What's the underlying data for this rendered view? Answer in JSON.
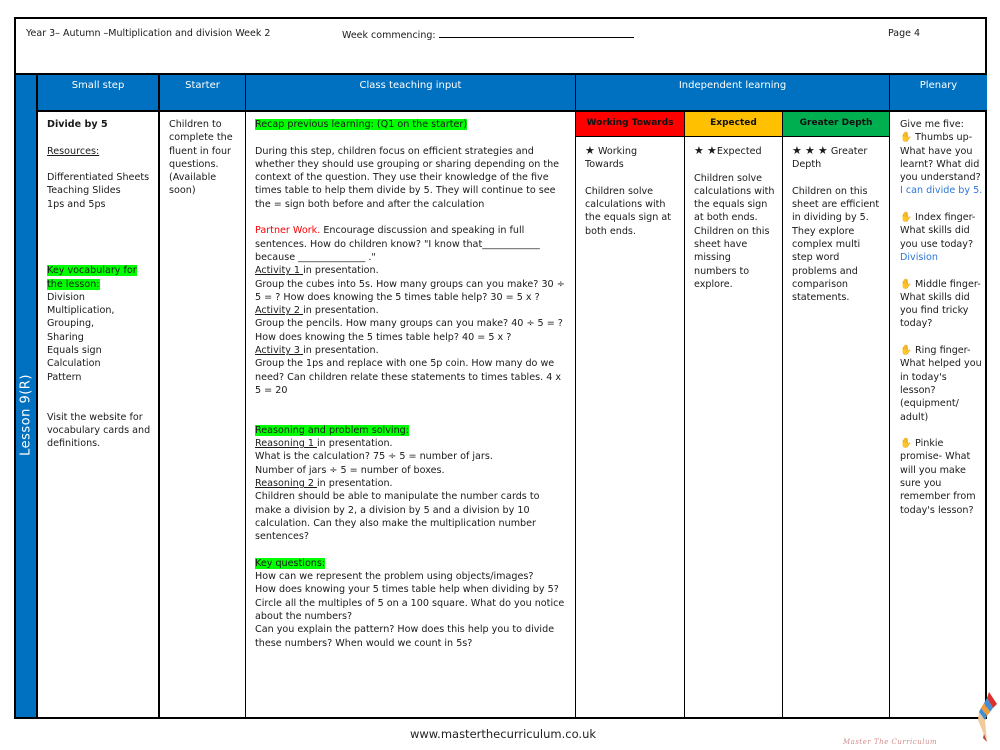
{
  "header": {
    "title": "Year 3– Autumn –Multiplication and division Week 2",
    "week_commencing_label": "Week commencing:",
    "page": "Page 4"
  },
  "side_label": "Lesson 9(R)",
  "columns": {
    "small_step": "Small step",
    "starter": "Starter",
    "class_teaching": "Class teaching input",
    "independent": "Independent learning",
    "plenary": "Plenary"
  },
  "small_step": {
    "title": "Divide by 5",
    "resources_label": "Resources:",
    "resources": [
      "Differentiated Sheets",
      "Teaching Slides",
      "1ps and 5ps"
    ],
    "vocab_label": "Key vocabulary for the lesson:",
    "vocab": [
      "Division",
      "Multiplication,",
      "Grouping,",
      "Sharing",
      "Equals sign",
      "Calculation",
      "Pattern"
    ],
    "website_note": "Visit the website for vocabulary cards and definitions."
  },
  "starter": {
    "text": "Children to complete the fluent in four questions. (Available soon)"
  },
  "teaching": {
    "recap": "Recap previous learning: (Q1 on the starter)",
    "intro": "During this step, children focus on efficient strategies and whether they should use grouping or sharing depending on the context of the question. They use their knowledge of the five times table to help them divide by 5. They will continue to see the = sign both before and after the calculation",
    "partner_label": "Partner Work.",
    "partner_text": " Encourage discussion and speaking in full sentences. How do children know?  \"I know that____________ because ______________ .\"",
    "activities": [
      {
        "label": "Activity 1 ",
        "suffix": "in presentation.",
        "text": "Group the cubes into 5s. How many groups can you make? 30 ÷ 5 = ? How does knowing the 5 times table help? 30 = 5 x ?"
      },
      {
        "label": "Activity 2 ",
        "suffix": "in presentation.",
        "text": "Group the pencils. How many groups can you make? 40 ÷ 5 = ? How does knowing the 5 times table help? 40 = 5 x ?"
      },
      {
        "label": "Activity 3 ",
        "suffix": "in presentation.",
        "text": "Group the 1ps and replace with one 5p coin. How many do we need? Can children relate these statements to times tables. 4 x 5 = 20"
      }
    ],
    "reasoning_label": "Reasoning and problem solving:",
    "reasoning": [
      {
        "label": "Reasoning 1 ",
        "suffix": "in presentation.",
        "lines": [
          "What is the calculation? 75 ÷ 5 = number of jars.",
          "Number of jars ÷ 5 = number of boxes."
        ]
      },
      {
        "label": "Reasoning 2 ",
        "suffix": "in presentation.",
        "lines": [
          "Children should be able to manipulate the number cards to make a division by 2, a division by 5 and a division by 10 calculation. Can they also make the multiplication number sentences?"
        ]
      }
    ],
    "key_questions_label": "Key questions:",
    "key_questions": [
      "How can we represent the problem using objects/images?",
      "How does knowing your 5 times table help when dividing by 5?",
      "Circle all the multiples of 5 on a 100 square. What do you notice about the numbers?",
      "Can you explain the pattern? How does this help you to divide these numbers? When would we count in 5s?"
    ]
  },
  "independent": {
    "levels": [
      {
        "name": "Working Towards",
        "color": "#ff0000",
        "stars": 1,
        "star_label": "Working Towards",
        "text": "Children solve calculations with the equals sign at both ends."
      },
      {
        "name": "Expected",
        "color": "#ffc000",
        "stars": 2,
        "star_label": "Expected",
        "text": "Children solve calculations with the equals sign at both ends. Children on this sheet have missing numbers to explore."
      },
      {
        "name": "Greater Depth",
        "color": "#00b050",
        "stars": 3,
        "star_label": "Greater Depth",
        "text": "Children on this sheet are efficient in dividing by 5. They explore complex multi step word problems and comparison statements."
      }
    ]
  },
  "plenary": {
    "intro": "Give me five:",
    "items": [
      {
        "icon": "hand-icon",
        "text": "Thumbs up- What have you learnt? What did you understand?",
        "answer": "I can divide by 5."
      },
      {
        "icon": "hand-icon",
        "text": "Index finger- What skills did you use today?",
        "answer": "Division"
      },
      {
        "icon": "hand-icon",
        "text": "Middle finger- What skills did you find tricky today?",
        "answer": ""
      },
      {
        "icon": "hand-icon",
        "text": "Ring finger- What helped you in today's lesson? (equipment/ adult)",
        "answer": ""
      },
      {
        "icon": "hand-icon",
        "text": "Pinkie promise- What will you make sure you remember from today's lesson?",
        "answer": ""
      }
    ]
  },
  "footer": {
    "url": "www.masterthecurriculum.co.uk",
    "brand": "Master The Curriculum"
  },
  "colors": {
    "header_blue": "#0070c0",
    "highlight_green": "#00ff00",
    "partner_red": "#ff0000",
    "answer_blue": "#2e75d6"
  }
}
